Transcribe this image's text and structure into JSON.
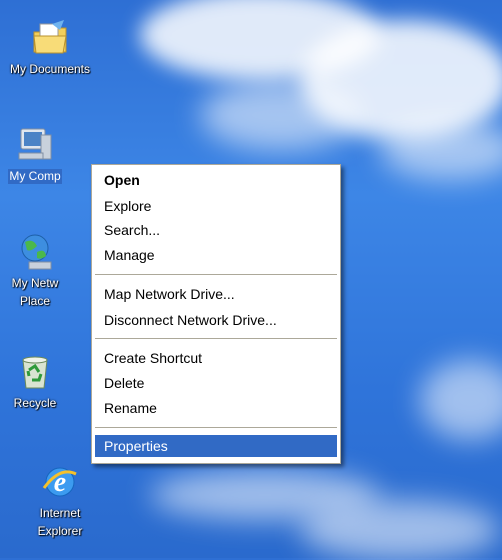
{
  "desktop": {
    "icons": [
      {
        "label": "My Documents",
        "icon": "my-documents-icon"
      },
      {
        "label": "My Comp",
        "icon": "my-computer-icon"
      },
      {
        "label": "My Netw",
        "label2": "Place",
        "icon": "network-places-icon"
      },
      {
        "label": "Recycle",
        "icon": "recycle-bin-icon"
      },
      {
        "label": "Internet",
        "label2": "Explorer",
        "icon": "internet-explorer-icon"
      }
    ]
  },
  "context_menu": {
    "items": [
      {
        "label": "Open",
        "bold": true
      },
      {
        "label": "Explore"
      },
      {
        "label": "Search..."
      },
      {
        "label": "Manage"
      },
      {
        "label": "Map Network Drive..."
      },
      {
        "label": "Disconnect Network Drive..."
      },
      {
        "label": "Create Shortcut"
      },
      {
        "label": "Delete"
      },
      {
        "label": "Rename"
      },
      {
        "label": "Properties",
        "highlighted": true
      }
    ]
  },
  "colors": {
    "highlight": "#316ac5",
    "menu_border": "#aca899",
    "desktop_blue": "#3d86e6"
  }
}
